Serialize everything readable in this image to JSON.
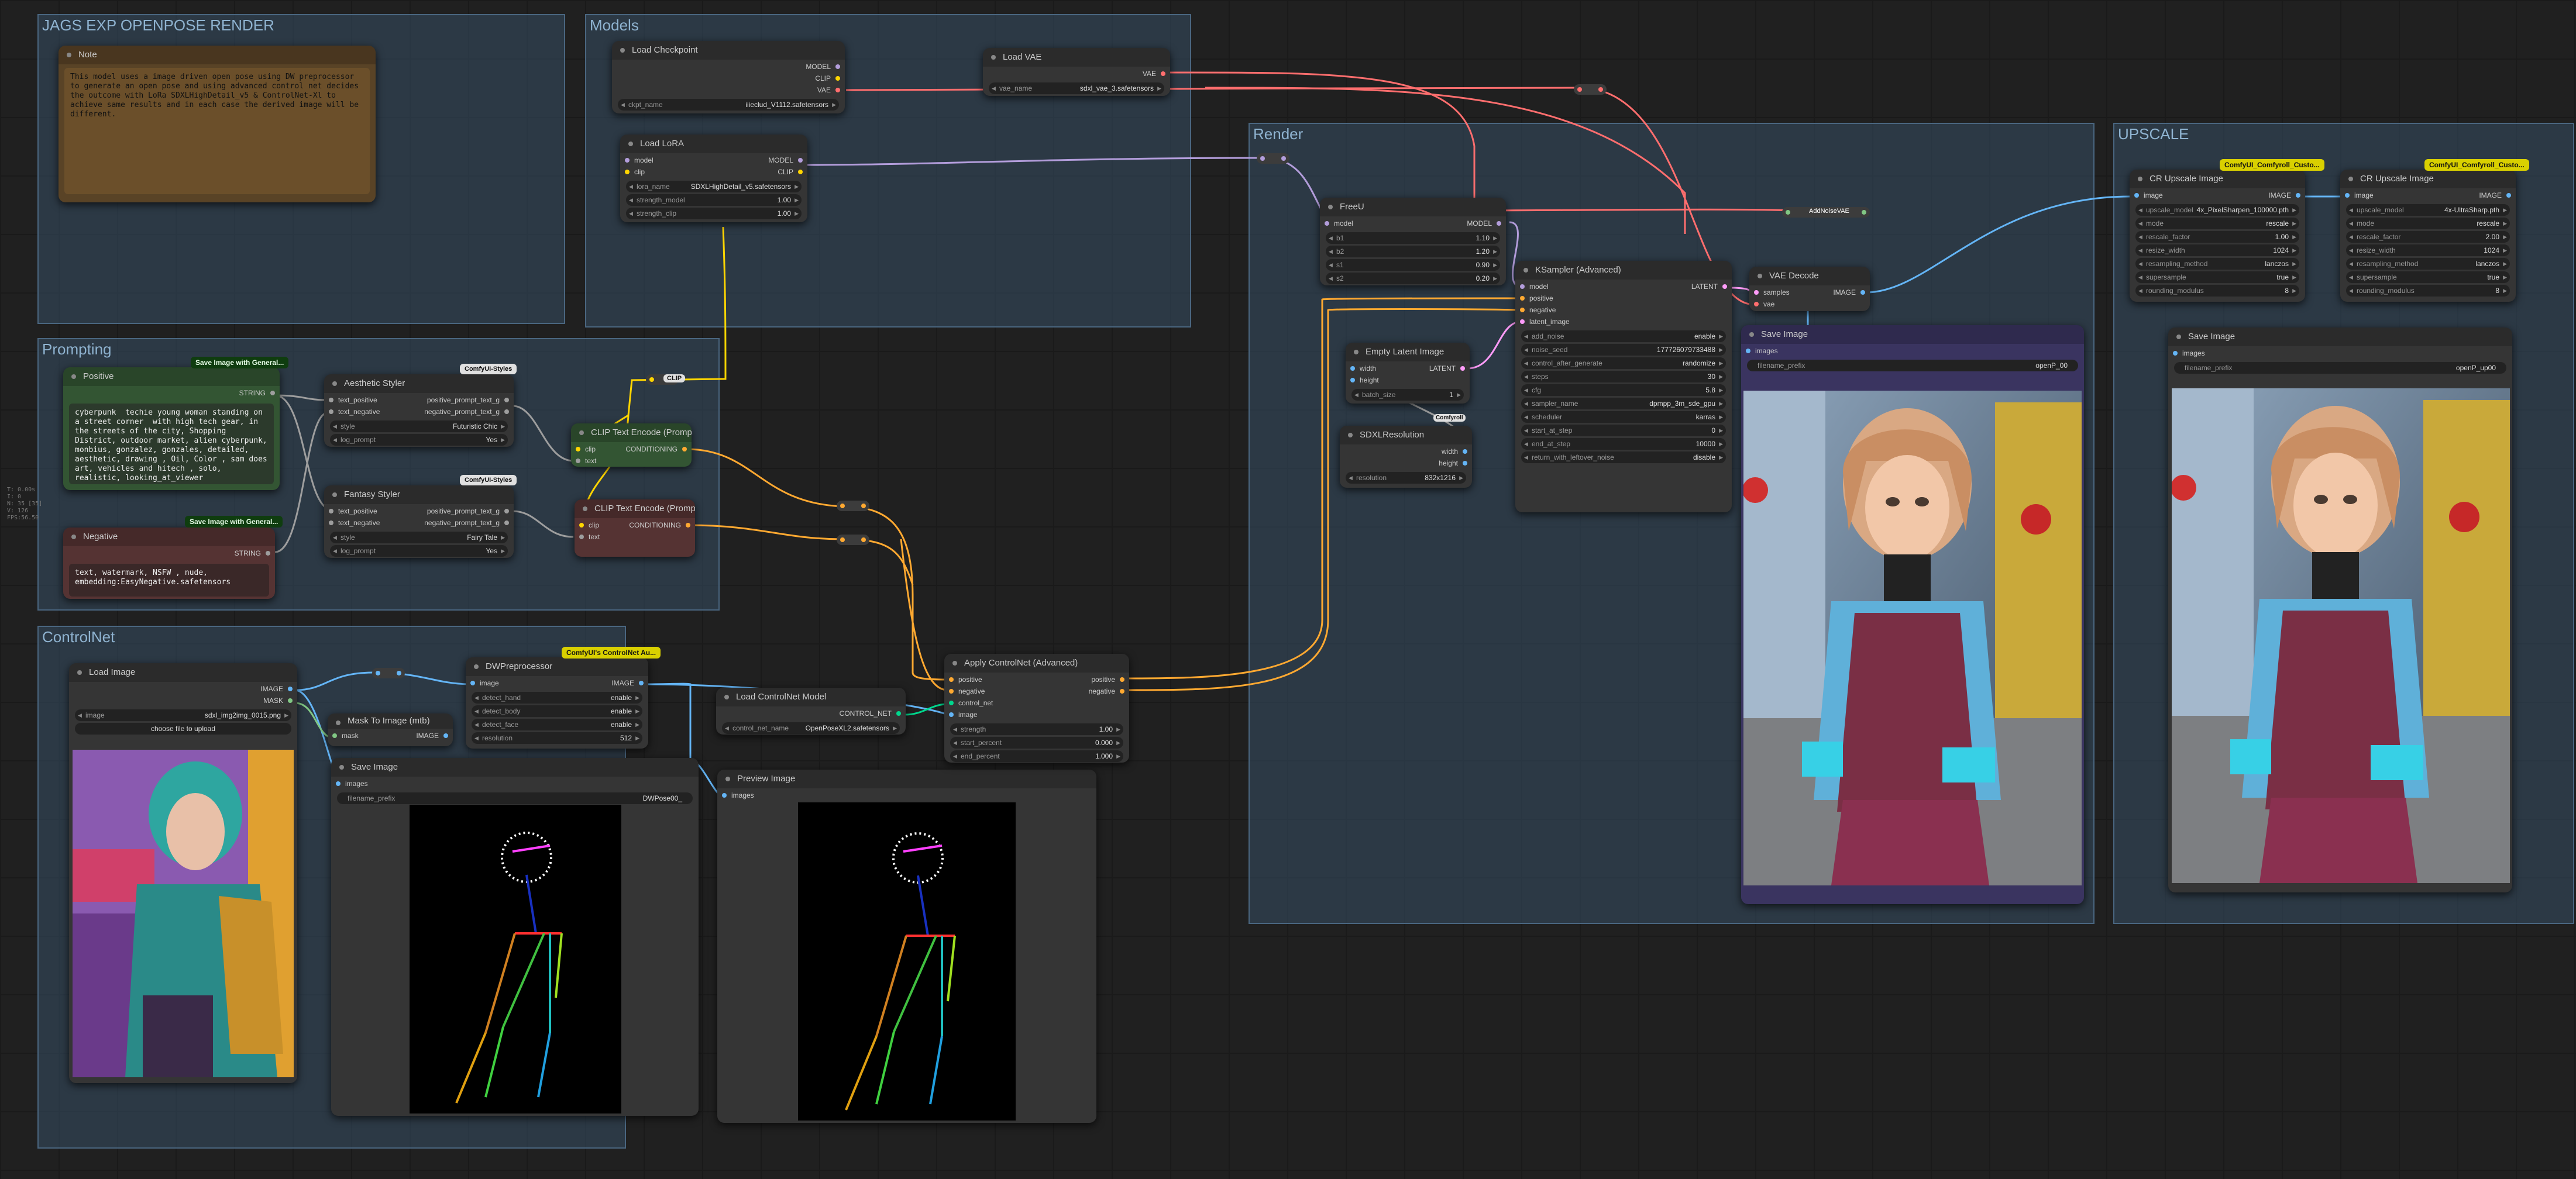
{
  "groups": {
    "jags": "JAGS EXP OPENPOSE RENDER",
    "models": "Models",
    "prompting": "Prompting",
    "render": "Render",
    "upscale": "UPSCALE",
    "controlnet": "ControlNet"
  },
  "colors": {
    "clip": "#ffd500",
    "model": "#b39ddb",
    "vae": "#ff6e6e",
    "conditioning": "#ffa931",
    "image": "#64b5f6",
    "latent": "#ff9cf9",
    "mask": "#81c784",
    "control_net": "#00d78d",
    "string": "#9e9e9e"
  },
  "nodes": {
    "note": {
      "title": "Note",
      "text": "This model uses a image driven open pose using DW preprocessor to generate an open pose and using advanced control net decides the outcome with LoRa SDXLHighDetail_v5 & ControlNet-Xl to achieve same results and in each case the derived image will be different."
    },
    "load_checkpoint": {
      "title": "Load Checkpoint",
      "out_model": "MODEL",
      "out_clip": "CLIP",
      "out_vae": "VAE",
      "w_label": "ckpt_name",
      "w_value": "iiieclud_V1112.safetensors"
    },
    "load_vae": {
      "title": "Load VAE",
      "out_vae": "VAE",
      "w_label": "vae_name",
      "w_value": "sdxl_vae_3.safetensors"
    },
    "load_lora": {
      "title": "Load LoRA",
      "in_model": "model",
      "in_clip": "clip",
      "out_model": "MODEL",
      "out_clip": "CLIP",
      "w1_label": "lora_name",
      "w1_value": "SDXLHighDetail_v5.safetensors",
      "w2_label": "strength_model",
      "w2_value": "1.00",
      "w3_label": "strength_clip",
      "w3_value": "1.00"
    },
    "positive": {
      "title": "Positive",
      "out": "STRING",
      "text": "cyberpunk  techie young woman standing on a street corner  with high tech gear, in the streets of the city, Shopping District, outdoor market, alien cyberpunk, monbius, gonzalez, gonzales, detailed, aesthetic, drawing , Oil, Color , sam does art, vehicles and hitech , solo, realistic, looking_at_viewer"
    },
    "negative": {
      "title": "Negative",
      "out": "STRING",
      "text": "text, watermark, NSFW , nude, embedding:EasyNegative.safetensors"
    },
    "aesthetic_styler": {
      "title": "Aesthetic Styler",
      "in1": "text_positive",
      "in2": "text_negative",
      "out1": "positive_prompt_text_g",
      "out2": "negative_prompt_text_g",
      "w1_label": "style",
      "w1_value": "Futuristic Chic",
      "w2_label": "log_prompt",
      "w2_value": "Yes"
    },
    "fantasy_styler": {
      "title": "Fantasy Styler",
      "in1": "text_positive",
      "in2": "text_negative",
      "out1": "positive_prompt_text_g",
      "out2": "negative_prompt_text_g",
      "w1_label": "style",
      "w1_value": "Fairy Tale",
      "w2_label": "log_prompt",
      "w2_value": "Yes"
    },
    "clip_pos": {
      "title": "CLIP Text Encode (Prompt)",
      "in1": "clip",
      "in2": "text",
      "out": "CONDITIONING"
    },
    "clip_neg": {
      "title": "CLIP Text Encode (Prompt)",
      "in1": "clip",
      "in2": "text",
      "out": "CONDITIONING"
    },
    "freeu": {
      "title": "FreeU",
      "in": "model",
      "out": "MODEL",
      "w": [
        [
          "b1",
          "1.10"
        ],
        [
          "b2",
          "1.20"
        ],
        [
          "s1",
          "0.90"
        ],
        [
          "s2",
          "0.20"
        ]
      ]
    },
    "empty_latent": {
      "title": "Empty Latent Image",
      "in1": "width",
      "in2": "height",
      "out": "LATENT",
      "w_label": "batch_size",
      "w_value": "1"
    },
    "sdxl_res": {
      "title": "SDXLResolution",
      "out1": "width",
      "out2": "height",
      "w_label": "resolution",
      "w_value": "832x1216"
    },
    "ksampler": {
      "title": "KSampler (Advanced)",
      "in": [
        "model",
        "positive",
        "negative",
        "latent_image"
      ],
      "out": "LATENT",
      "w": [
        [
          "add_noise",
          "enable"
        ],
        [
          "noise_seed",
          "177726079733488"
        ],
        [
          "control_after_generate",
          "randomize"
        ],
        [
          "steps",
          "30"
        ],
        [
          "cfg",
          "5.8"
        ],
        [
          "sampler_name",
          "dpmpp_3m_sde_gpu"
        ],
        [
          "scheduler",
          "karras"
        ],
        [
          "start_at_step",
          "0"
        ],
        [
          "end_at_step",
          "10000"
        ],
        [
          "return_with_leftover_noise",
          "disable"
        ]
      ]
    },
    "vae_decode": {
      "title": "VAE Decode",
      "in1": "samples",
      "in2": "vae",
      "out": "IMAGE"
    },
    "save_render": {
      "title": "Save Image",
      "in": "images",
      "w_label": "filename_prefix",
      "w_value": "openP_00"
    },
    "cr_upscale1": {
      "title": "CR Upscale Image",
      "badge": "ComfyUI_Comfyroll_Custo...",
      "in": "image",
      "out": "IMAGE",
      "w": [
        [
          "upscale_model",
          "4x_PixelSharpen_100000.pth"
        ],
        [
          "mode",
          "rescale"
        ],
        [
          "rescale_factor",
          "1.00"
        ],
        [
          "resize_width",
          "1024"
        ],
        [
          "resampling_method",
          "lanczos"
        ],
        [
          "supersample",
          "true"
        ],
        [
          "rounding_modulus",
          "8"
        ]
      ]
    },
    "cr_upscale2": {
      "title": "CR Upscale Image",
      "badge": "ComfyUI_Comfyroll_Custo...",
      "in": "image",
      "out": "IMAGE",
      "w": [
        [
          "upscale_model",
          "4x-UltraSharp.pth"
        ],
        [
          "mode",
          "rescale"
        ],
        [
          "rescale_factor",
          "2.00"
        ],
        [
          "resize_width",
          "1024"
        ],
        [
          "resampling_method",
          "lanczos"
        ],
        [
          "supersample",
          "true"
        ],
        [
          "rounding_modulus",
          "8"
        ]
      ]
    },
    "save_upscale": {
      "title": "Save Image",
      "in": "images",
      "w_label": "filename_prefix",
      "w_value": "openP_up00"
    },
    "load_image": {
      "title": "Load Image",
      "out1": "IMAGE",
      "out2": "MASK",
      "w_label": "image",
      "w_value": "sdxl_img2img_0015.png",
      "button": "choose file to upload"
    },
    "mask_to_image": {
      "title": "Mask To Image (mtb)",
      "in": "mask",
      "out": "IMAGE"
    },
    "dwpre": {
      "title": "DWPreprocessor",
      "badge": "ComfyUI's ControlNet Au...",
      "in": "image",
      "out": "IMAGE",
      "w": [
        [
          "detect_hand",
          "enable"
        ],
        [
          "detect_body",
          "enable"
        ],
        [
          "detect_face",
          "enable"
        ],
        [
          "resolution",
          "512"
        ]
      ]
    },
    "save_cn": {
      "title": "Save Image",
      "in": "images",
      "w_label": "filename_prefix",
      "w_value": "DWPose00_"
    },
    "load_cn_model": {
      "title": "Load ControlNet Model",
      "out": "CONTROL_NET",
      "w_label": "control_net_name",
      "w_value": "OpenPoseXL2.safetensors"
    },
    "preview": {
      "title": "Preview Image",
      "in": "images"
    },
    "apply_cn": {
      "title": "Apply ControlNet (Advanced)",
      "in": [
        "positive",
        "negative",
        "control_net",
        "image"
      ],
      "out1": "positive",
      "out2": "negative",
      "w": [
        [
          "strength",
          "1.00"
        ],
        [
          "start_percent",
          "0.000"
        ],
        [
          "end_percent",
          "1.000"
        ]
      ]
    }
  },
  "badges": {
    "save_with_general": "Save Image with General...",
    "comfyui_styles": "ComfyUI-Styles",
    "clip_label": "CLIP",
    "addnoise": "AddNoiseVAE",
    "comfyroll": "Comfyroll"
  },
  "sidestat": [
    "T: 0.00s",
    "I: 0",
    "N: 35 [35]",
    "V: 126",
    "FPS:56.50"
  ]
}
